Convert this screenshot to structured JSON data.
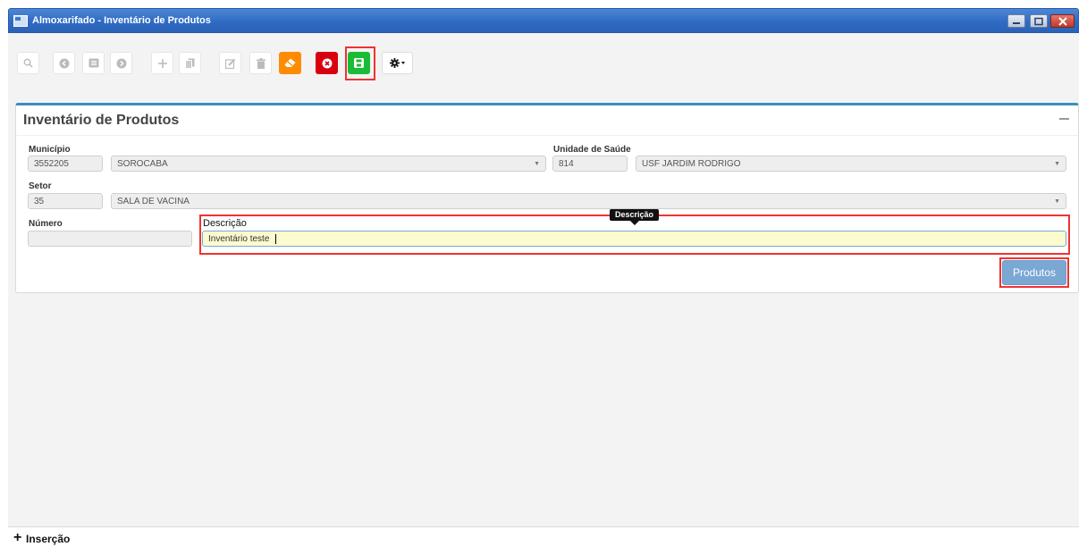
{
  "window": {
    "title": "Almoxarifado - Inventário de Produtos"
  },
  "toolbar": {
    "buttons": [
      {
        "name": "search",
        "icon": "search-icon"
      },
      {
        "name": "previous",
        "icon": "arrow-left-icon"
      },
      {
        "name": "list",
        "icon": "list-icon"
      },
      {
        "name": "next",
        "icon": "arrow-right-icon"
      },
      {
        "name": "add",
        "icon": "plus-icon"
      },
      {
        "name": "copy",
        "icon": "copy-icon"
      },
      {
        "name": "edit",
        "icon": "edit-icon"
      },
      {
        "name": "delete",
        "icon": "trash-icon"
      },
      {
        "name": "clear",
        "icon": "eraser-icon",
        "color": "#ff8c00"
      },
      {
        "name": "cancel",
        "icon": "close-circle-icon",
        "color": "#d9000d"
      },
      {
        "name": "save",
        "icon": "save-icon",
        "color": "#1bbc35"
      },
      {
        "name": "settings",
        "icon": "gear-icon"
      }
    ]
  },
  "panel": {
    "title": "Inventário de Produtos"
  },
  "form": {
    "municipio": {
      "label": "Município",
      "code": "3552205",
      "name": "SOROCABA"
    },
    "unidade": {
      "label": "Unidade de Saúde",
      "code": "814",
      "name": "USF JARDIM RODRIGO"
    },
    "setor": {
      "label": "Setor",
      "code": "35",
      "name": "SALA DE VACINA"
    },
    "numero": {
      "label": "Número",
      "value": ""
    },
    "descricao": {
      "label": "Descrição",
      "value": "Inventário teste",
      "tooltip": "Descrição"
    }
  },
  "buttons": {
    "produtos": "Produtos"
  },
  "footer": {
    "icon": "plus-icon",
    "label": "Inserção"
  },
  "colors": {
    "accent": "#3c8dbc",
    "titlebar": "#2f6bc4",
    "highlight": "#ee3333",
    "produtos_button": "#7ba7d3"
  }
}
